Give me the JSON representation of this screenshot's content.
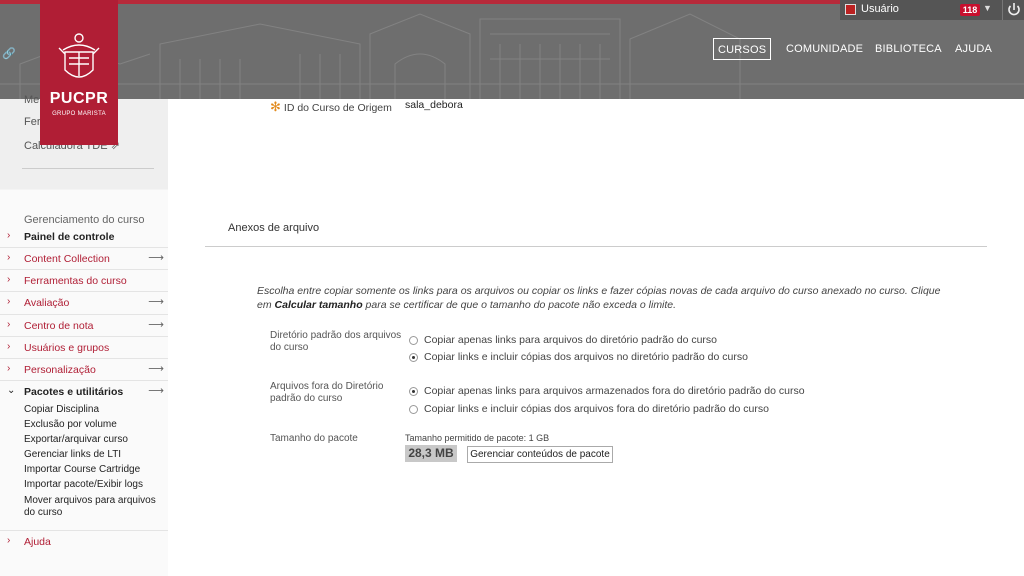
{
  "header": {
    "logo_name": "PUCPR",
    "logo_sub": "GRUPO MARISTA",
    "user_name": "Usuário",
    "notification_count": "118",
    "nav": [
      {
        "label": "CURSOS"
      },
      {
        "label": "COMUNIDADE"
      },
      {
        "label": "BIBLIOTECA"
      },
      {
        "label": "AJUDA"
      }
    ]
  },
  "sidebar": {
    "tools": [
      "Me",
      "Fer",
      "Calculadora TDE"
    ],
    "section_title": "Gerenciamento do curso",
    "menu": [
      {
        "label": "Painel de controle",
        "arrow": ""
      },
      {
        "label": "Content Collection",
        "arrow": "⟶"
      },
      {
        "label": "Ferramentas do curso",
        "arrow": ""
      },
      {
        "label": "Avaliação",
        "arrow": "⟶"
      },
      {
        "label": "Centro de nota",
        "arrow": "⟶"
      },
      {
        "label": "Usuários e grupos",
        "arrow": ""
      },
      {
        "label": "Personalização",
        "arrow": "⟶"
      },
      {
        "label": "Pacotes e utilitários",
        "arrow": "⟶"
      }
    ],
    "sub_items": [
      "Copiar Disciplina",
      "Exclusão por volume",
      "Exportar/arquivar curso",
      "Gerenciar links de LTI",
      "Importar Course Cartridge",
      "Importar pacote/Exibir logs",
      "Mover arquivos para arquivos do curso"
    ],
    "help": "Ajuda"
  },
  "main": {
    "origin_label": "ID do Curso de Origem",
    "origin_value": "sala_debora",
    "section_heading": "Anexos de arquivo",
    "intro_part1": "Escolha entre copiar somente os links para os arquivos ou copiar os links e fazer cópias novas de cada arquivo do curso anexado no curso. Clique em ",
    "intro_bold": "Calcular tamanho",
    "intro_part2": " para se certificar de que o tamanho do pacote não exceda o limite.",
    "default_dir_label": "Diretório padrão dos arquivos do curso",
    "default_dir_options": [
      {
        "label": "Copiar apenas links para arquivos do diretório padrão do curso",
        "selected": false
      },
      {
        "label": "Copiar links e incluir cópias dos arquivos no diretório padrão do curso",
        "selected": true
      }
    ],
    "outside_dir_label": "Arquivos fora do Diretório padrão do curso",
    "outside_dir_options": [
      {
        "label": "Copiar apenas links para arquivos armazenados fora do diretório padrão do curso",
        "selected": true
      },
      {
        "label": "Copiar links e incluir cópias dos arquivos fora do diretório padrão do curso",
        "selected": false
      }
    ],
    "package_size_label": "Tamanho do pacote",
    "allowed_size": "Tamanho permitido de pacote:  1 GB",
    "package_size_value": "28,3 MB",
    "manage_button": "Gerenciar conteúdos de pacote"
  }
}
